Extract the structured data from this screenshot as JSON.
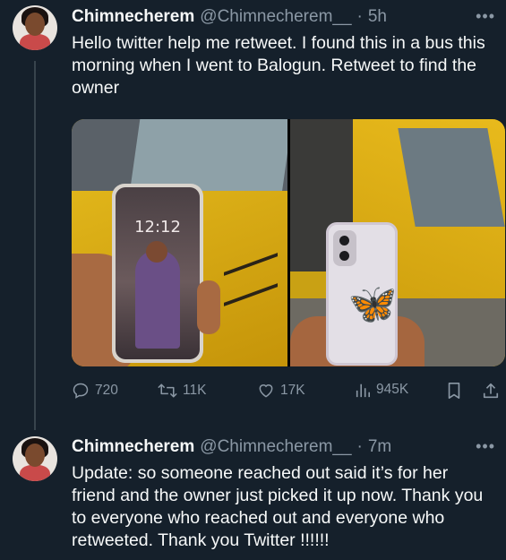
{
  "tweets": [
    {
      "display_name": "Chimnecherem",
      "handle": "@Chimnecherem__",
      "separator": "·",
      "time": "5h",
      "text": "Hello twitter help me retweet. I found this in a bus this morning when I went to Balogun. Retweet to find the owner",
      "media": [
        {
          "phone_lockscreen_time": "12:12"
        },
        {
          "case_decoration": "🦋"
        }
      ],
      "actions": {
        "replies": "720",
        "retweets": "11K",
        "likes": "17K",
        "views": "945K"
      }
    },
    {
      "display_name": "Chimnecherem",
      "handle": "@Chimnecherem__",
      "separator": "·",
      "time": "7m",
      "text": "Update: so someone reached out said it’s for her friend and the owner just picked it up now. Thank you to everyone who reached out and everyone who retweeted. Thank you Twitter !!!!!!"
    }
  ],
  "icons": {
    "more": "•••",
    "reply": "reply-icon",
    "retweet": "retweet-icon",
    "like": "heart-icon",
    "views": "views-icon",
    "bookmark": "bookmark-icon",
    "share": "share-icon"
  },
  "colors": {
    "background": "#15202b",
    "text": "#f7f9f9",
    "secondary": "#8b98a5"
  }
}
